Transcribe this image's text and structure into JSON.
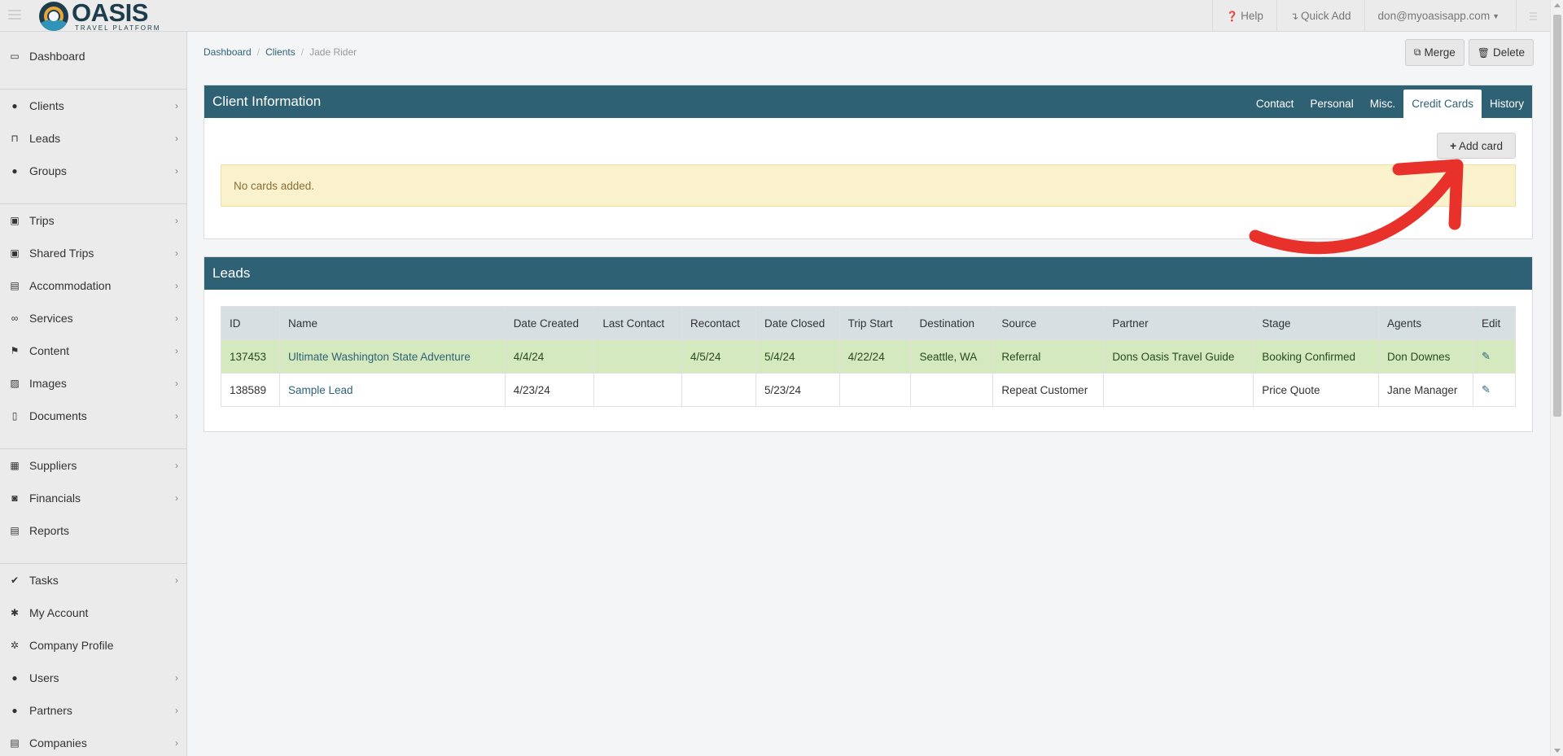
{
  "topbar": {
    "logo_name": "OASIS",
    "logo_tagline": "TRAVEL PLATFORM",
    "help_label": "Help",
    "quick_add_label": "Quick Add",
    "user_email": "don@myoasisapp.com"
  },
  "sidebar": {
    "items": [
      {
        "label": "Dashboard",
        "icon": "monitor-icon",
        "glyph": "▭",
        "chevron": false
      },
      {
        "label": "Clients",
        "icon": "user-icon",
        "glyph": "●",
        "chevron": true
      },
      {
        "label": "Leads",
        "icon": "inbox-icon",
        "glyph": "⊓",
        "chevron": true
      },
      {
        "label": "Groups",
        "icon": "users-icon",
        "glyph": "●",
        "chevron": true
      },
      {
        "label": "Trips",
        "icon": "suitcase-icon",
        "glyph": "▣",
        "chevron": true
      },
      {
        "label": "Shared Trips",
        "icon": "suitcase-icon",
        "glyph": "▣",
        "chevron": true
      },
      {
        "label": "Accommodation",
        "icon": "building-icon",
        "glyph": "▤",
        "chevron": true
      },
      {
        "label": "Services",
        "icon": "binoculars-icon",
        "glyph": "∞",
        "chevron": true
      },
      {
        "label": "Content",
        "icon": "flag-icon",
        "glyph": "⚑",
        "chevron": true
      },
      {
        "label": "Images",
        "icon": "image-icon",
        "glyph": "▨",
        "chevron": true
      },
      {
        "label": "Documents",
        "icon": "pdf-file-icon",
        "glyph": "▯",
        "chevron": true
      },
      {
        "label": "Suppliers",
        "icon": "archive-icon",
        "glyph": "▦",
        "chevron": true
      },
      {
        "label": "Financials",
        "icon": "money-icon",
        "glyph": "◙",
        "chevron": true
      },
      {
        "label": "Reports",
        "icon": "table-icon",
        "glyph": "▤",
        "chevron": false
      },
      {
        "label": "Tasks",
        "icon": "check-icon",
        "glyph": "✔",
        "chevron": true
      },
      {
        "label": "My Account",
        "icon": "gear-icon",
        "glyph": "✱",
        "chevron": false
      },
      {
        "label": "Company Profile",
        "icon": "gears-icon",
        "glyph": "✲",
        "chevron": false
      },
      {
        "label": "Users",
        "icon": "user-icon",
        "glyph": "●",
        "chevron": true
      },
      {
        "label": "Partners",
        "icon": "users-icon",
        "glyph": "●",
        "chevron": true
      },
      {
        "label": "Companies",
        "icon": "building-icon",
        "glyph": "▤",
        "chevron": true
      }
    ],
    "help_button": "?"
  },
  "breadcrumb": {
    "items": [
      "Dashboard",
      "Clients",
      "Jade Rider"
    ]
  },
  "actions": {
    "merge_label": "Merge",
    "delete_label": "Delete"
  },
  "client_panel": {
    "title": "Client Information",
    "tabs": [
      "Contact",
      "Personal",
      "Misc.",
      "Credit Cards",
      "History"
    ],
    "active_tab": "Credit Cards",
    "add_card_label": "Add card",
    "alert_text": "No cards added."
  },
  "leads_panel": {
    "title": "Leads",
    "columns": [
      "ID",
      "Name",
      "Date Created",
      "Last Contact",
      "Recontact",
      "Date Closed",
      "Trip Start",
      "Destination",
      "Source",
      "Partner",
      "Stage",
      "Agents",
      "Edit"
    ],
    "rows": [
      {
        "id": "137453",
        "name": "Ultimate Washington State Adventure",
        "date_created": "4/4/24",
        "last_contact": "",
        "recontact": "4/5/24",
        "date_closed": "5/4/24",
        "trip_start": "4/22/24",
        "destination": "Seattle, WA",
        "source": "Referral",
        "partner": "Dons Oasis Travel Guide",
        "stage": "Booking Confirmed",
        "agents": "Don Downes",
        "highlight": true
      },
      {
        "id": "138589",
        "name": "Sample Lead",
        "date_created": "4/23/24",
        "last_contact": "",
        "recontact": "",
        "date_closed": "5/23/24",
        "trip_start": "",
        "destination": "",
        "source": "Repeat Customer",
        "partner": "",
        "stage": "Price Quote",
        "agents": "Jane Manager",
        "highlight": false
      }
    ]
  },
  "colors": {
    "panel_header": "#2f6174",
    "row_highlight": "#d4e9be",
    "alert_bg": "#faf2cc",
    "annotation_arrow": "#e8312a"
  }
}
